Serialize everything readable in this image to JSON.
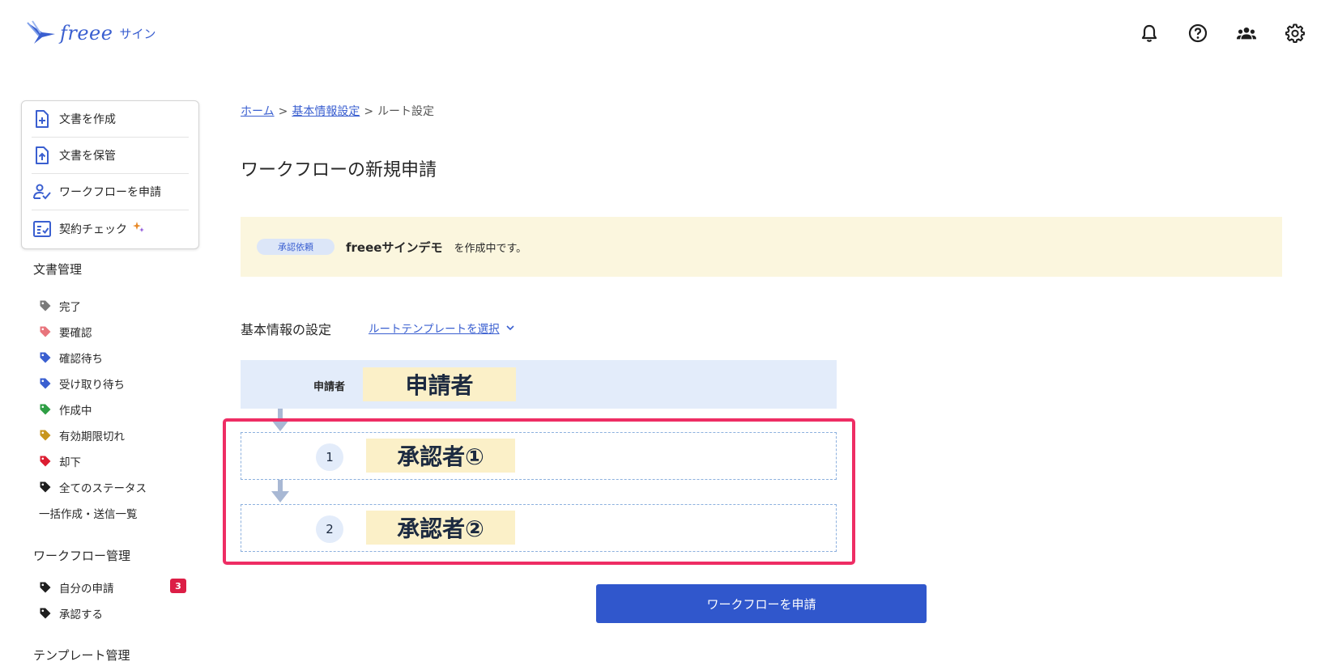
{
  "header": {
    "logo_text": "freee",
    "logo_sub": "サイン",
    "icons": [
      "bell-icon",
      "help-icon",
      "users-icon",
      "gear-icon"
    ]
  },
  "sidebar": {
    "quick_actions": [
      {
        "label": "文書を作成",
        "icon": "document-plus-icon"
      },
      {
        "label": "文書を保管",
        "icon": "document-upload-icon"
      },
      {
        "label": "ワークフローを申請",
        "icon": "user-check-icon"
      },
      {
        "label": "契約チェック",
        "icon": "checklist-icon"
      }
    ],
    "doc_heading": "文書管理",
    "doc_tags": [
      {
        "label": "完了",
        "color": "#7a7a7a"
      },
      {
        "label": "要確認",
        "color": "#e8747c"
      },
      {
        "label": "確認待ち",
        "color": "#3a5fd0"
      },
      {
        "label": "受け取り待ち",
        "color": "#3a5fd0"
      },
      {
        "label": "作成中",
        "color": "#2e9e44"
      },
      {
        "label": "有効期限切れ",
        "color": "#c8961e"
      },
      {
        "label": "却下",
        "color": "#dc1e32"
      },
      {
        "label": "全てのステータス",
        "color": "#1e1e1e"
      }
    ],
    "bulk_link": "一括作成・送信一覧",
    "workflow_heading": "ワークフロー管理",
    "workflow_items": [
      {
        "label": "自分の申請",
        "color": "#1e1e1e",
        "badge": "3"
      },
      {
        "label": "承認する",
        "color": "#1e1e1e"
      }
    ],
    "template_heading": "テンプレート管理"
  },
  "breadcrumb": {
    "home": "ホーム",
    "basic": "基本情報設定",
    "current": "ルート設定",
    "separator": ">"
  },
  "page_title": "ワークフローの新規申請",
  "banner": {
    "pill": "承認依頼",
    "doc_name": "freeeサインデモ",
    "suffix": "を作成中です。"
  },
  "basic_settings": {
    "label": "基本情報の設定",
    "template_link": "ルートテンプレートを選択"
  },
  "route": {
    "applicant_label": "申請者",
    "applicant_name": "申請者",
    "approvers": [
      {
        "step": "1",
        "name": "承認者①"
      },
      {
        "step": "2",
        "name": "承認者②"
      }
    ]
  },
  "submit_label": "ワークフローを申請",
  "colors": {
    "accent": "#3057cc",
    "highlight": "#ee2d64",
    "banner_bg": "#fbf6de",
    "route_bg": "#e3ecfa",
    "name_bg": "#fbf0c8"
  }
}
